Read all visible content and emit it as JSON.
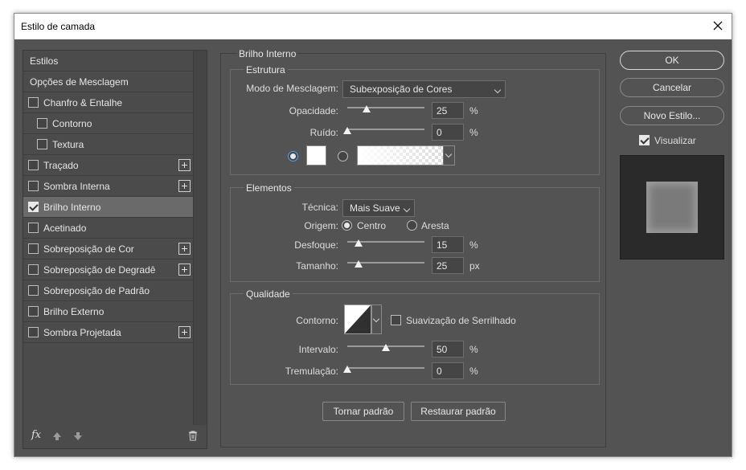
{
  "window": {
    "title": "Estilo de camada"
  },
  "sidebar": {
    "items": [
      {
        "label": "Estilos",
        "checkbox": false,
        "checked": false,
        "plus": false,
        "indent": false,
        "selected": false
      },
      {
        "label": "Opções de Mesclagem",
        "checkbox": false,
        "checked": false,
        "plus": false,
        "indent": false,
        "selected": false
      },
      {
        "label": "Chanfro & Entalhe",
        "checkbox": true,
        "checked": false,
        "plus": false,
        "indent": false,
        "selected": false
      },
      {
        "label": "Contorno",
        "checkbox": true,
        "checked": false,
        "plus": false,
        "indent": true,
        "selected": false
      },
      {
        "label": "Textura",
        "checkbox": true,
        "checked": false,
        "plus": false,
        "indent": true,
        "selected": false
      },
      {
        "label": "Traçado",
        "checkbox": true,
        "checked": false,
        "plus": true,
        "indent": false,
        "selected": false
      },
      {
        "label": "Sombra Interna",
        "checkbox": true,
        "checked": false,
        "plus": true,
        "indent": false,
        "selected": false
      },
      {
        "label": "Brilho Interno",
        "checkbox": true,
        "checked": true,
        "plus": false,
        "indent": false,
        "selected": true
      },
      {
        "label": "Acetinado",
        "checkbox": true,
        "checked": false,
        "plus": false,
        "indent": false,
        "selected": false
      },
      {
        "label": "Sobreposição de Cor",
        "checkbox": true,
        "checked": false,
        "plus": true,
        "indent": false,
        "selected": false
      },
      {
        "label": "Sobreposição de Degradê",
        "checkbox": true,
        "checked": false,
        "plus": true,
        "indent": false,
        "selected": false
      },
      {
        "label": "Sobreposição de Padrão",
        "checkbox": true,
        "checked": false,
        "plus": false,
        "indent": false,
        "selected": false
      },
      {
        "label": "Brilho Externo",
        "checkbox": true,
        "checked": false,
        "plus": false,
        "indent": false,
        "selected": false
      },
      {
        "label": "Sombra Projetada",
        "checkbox": true,
        "checked": false,
        "plus": true,
        "indent": false,
        "selected": false
      }
    ],
    "footer": {
      "fx_label": "fx"
    }
  },
  "main": {
    "title": "Brilho Interno",
    "structure": {
      "title": "Estrutura",
      "blend_mode_label": "Modo de Mesclagem:",
      "blend_mode_value": "Subexposição de Cores",
      "opacity_label": "Opacidade:",
      "opacity_value": "25",
      "opacity_unit": "%",
      "opacity_fraction": 0.25,
      "noise_label": "Ruído:",
      "noise_value": "0",
      "noise_unit": "%",
      "noise_fraction": 0.0,
      "color_swatch": "#ffffff"
    },
    "elements": {
      "title": "Elementos",
      "technique_label": "Técnica:",
      "technique_value": "Mais Suave",
      "source_label": "Origem:",
      "source_center": "Centro",
      "source_edge": "Aresta",
      "choke_label": "Desfoque:",
      "choke_value": "15",
      "choke_unit": "%",
      "choke_fraction": 0.15,
      "size_label": "Tamanho:",
      "size_value": "25",
      "size_unit": "px",
      "size_fraction": 0.15
    },
    "quality": {
      "title": "Qualidade",
      "contour_label": "Contorno:",
      "anti_alias_label": "Suavização de Serrilhado",
      "range_label": "Intervalo:",
      "range_value": "50",
      "range_unit": "%",
      "range_fraction": 0.5,
      "jitter_label": "Tremulação:",
      "jitter_value": "0",
      "jitter_unit": "%",
      "jitter_fraction": 0.0
    },
    "make_default": "Tornar padrão",
    "reset_default": "Restaurar padrão"
  },
  "right": {
    "ok": "OK",
    "cancel": "Cancelar",
    "new_style": "Novo Estilo...",
    "preview_label": "Visualizar"
  }
}
